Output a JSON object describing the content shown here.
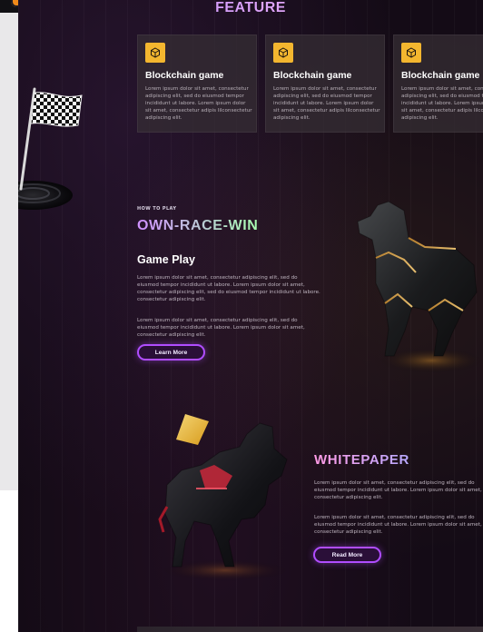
{
  "header": {
    "title": "FEATURE"
  },
  "cards": [
    {
      "title": "Blockchain game",
      "body": "Lorem ipsum dolor sit amet, consectetur adipiscing elit, sed do eiusmod tempor incididunt ut labore. Lorem ipsum dolor sit amet, consectetur adipis lilconsectetur adipiscing elit."
    },
    {
      "title": "Blockchain game",
      "body": "Lorem ipsum dolor sit amet, consectetur adipiscing elit, sed do eiusmod tempor incididunt ut labore. Lorem ipsum dolor sit amet, consectetur adipis lilconsectetur adipiscing elit."
    },
    {
      "title": "Blockchain game",
      "body": "Lorem ipsum dolor sit amet, consectetur adipiscing elit, sed do eiusmod tempor incididunt ut labore. Lorem ipsum dolor sit amet, consectetur adipis lilconsectetur adipiscing elit."
    }
  ],
  "howto": {
    "kicker": "HOW TO PLAY",
    "headline": "OWN-RACE-WIN",
    "title": "Game Play",
    "p1": "Lorem ipsum dolor sit amet, consectetur adipiscing elit, sed do eiusmod tempor incididunt ut labore. Lorem ipsum dolor sit amet, consectetur adipiscing elit, sed do eiusmod tempor incididunt ut labore. consectetur adipiscing elit.",
    "p2": "Lorem ipsum dolor sit amet, consectetur adipiscing elit, sed do eiusmod tempor incididunt ut labore. Lorem ipsum dolor sit amet, consectetur adipiscing elit.",
    "button": "Learn More"
  },
  "whitepaper": {
    "title": "WHITEPAPER",
    "p1": "Lorem ipsum dolor sit amet, consectetur adipiscing elit, sed do eiusmod tempor incididunt ut labore. Lorem ipsum dolor sit amet, consectetur adipiscing elit.",
    "p2": "Lorem ipsum dolor sit amet, consectetur adipiscing elit, sed do eiusmod tempor incididunt ut labore. Lorem ipsum dolor sit amet, consectetur adipiscing elit.",
    "button": "Read More"
  },
  "colors": {
    "background": "#140b16",
    "card": "#362e34",
    "badge": "#f3b62f",
    "button_border": "#b04dff"
  },
  "icons": {
    "card_badge": "cube-icon",
    "flag": "checkered-flag-icon",
    "horse1": "horse-illustration",
    "horse2": "horse-illustration"
  }
}
